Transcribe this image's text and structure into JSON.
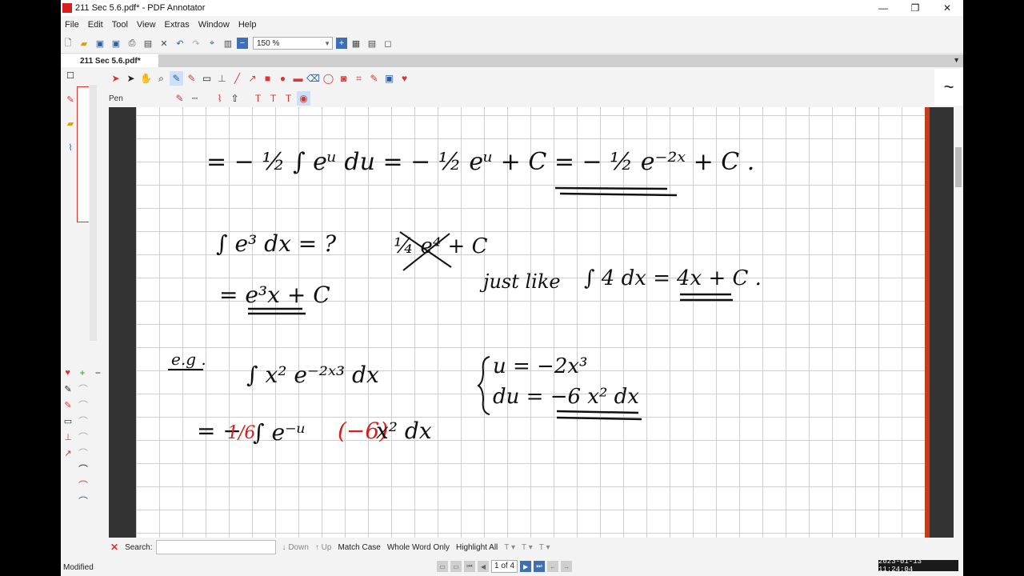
{
  "window": {
    "title": "211 Sec 5.6.pdf* - PDF Annotator",
    "minimize": "—",
    "maximize": "❐",
    "close": "✕"
  },
  "menu": [
    "File",
    "Edit",
    "Tool",
    "View",
    "Extras",
    "Window",
    "Help"
  ],
  "toolbar": {
    "zoom_value": "150 %"
  },
  "tabs": [
    {
      "label": "211 Sec 5.6.pdf*"
    }
  ],
  "annotation": {
    "tool_label": "Pen"
  },
  "ink": {
    "line1": "= − ½ ∫ eᵘ du = − ½ eᵘ + C = − ½ e⁻²ˣ + C .",
    "line2a": "∫ e³ dx = ?",
    "line2b": "¼ e⁴ + C",
    "line3a": "= e³x + C",
    "line3b": "just like",
    "line3c": "∫ 4 dx =",
    "line3d": "4x + C .",
    "line4a": "e.g .",
    "line4b": "∫ x² e⁻²ˣ³ dx",
    "line4c": "u = −2x³",
    "line4d": "du = −6 x² dx",
    "line5a": "= −",
    "line5b": "1/6",
    "line5c": "∫ e⁻ᵘ",
    "line5d": "(−6)",
    "line5e": "x² dx"
  },
  "search": {
    "label": "Search:",
    "value": "",
    "down": "Down",
    "up": "Up",
    "match_case": "Match Case",
    "whole_word": "Whole Word Only",
    "highlight_all": "Highlight All"
  },
  "status": {
    "text": "Modified",
    "page_indicator": "1 of 4"
  },
  "timestamp": "2023-01-13 11:24:04",
  "colors": {
    "accent_red": "#d81e1e",
    "ink_black": "#111111",
    "ink_red": "#d81e1e",
    "page_nav_blue": "#3e6fb5"
  }
}
